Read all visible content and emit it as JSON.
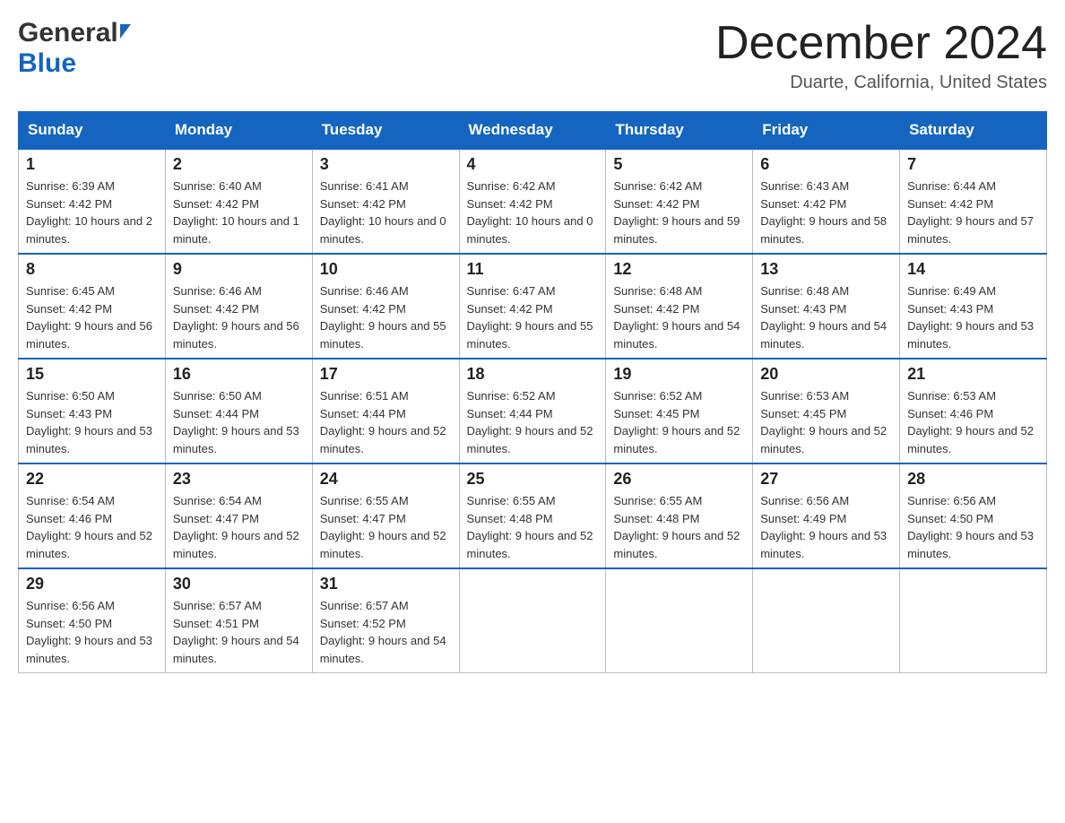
{
  "header": {
    "logo_general": "General",
    "logo_blue": "Blue",
    "month_title": "December 2024",
    "location": "Duarte, California, United States"
  },
  "weekdays": [
    "Sunday",
    "Monday",
    "Tuesday",
    "Wednesday",
    "Thursday",
    "Friday",
    "Saturday"
  ],
  "weeks": [
    [
      {
        "day": "1",
        "sunrise": "Sunrise: 6:39 AM",
        "sunset": "Sunset: 4:42 PM",
        "daylight": "Daylight: 10 hours and 2 minutes."
      },
      {
        "day": "2",
        "sunrise": "Sunrise: 6:40 AM",
        "sunset": "Sunset: 4:42 PM",
        "daylight": "Daylight: 10 hours and 1 minute."
      },
      {
        "day": "3",
        "sunrise": "Sunrise: 6:41 AM",
        "sunset": "Sunset: 4:42 PM",
        "daylight": "Daylight: 10 hours and 0 minutes."
      },
      {
        "day": "4",
        "sunrise": "Sunrise: 6:42 AM",
        "sunset": "Sunset: 4:42 PM",
        "daylight": "Daylight: 10 hours and 0 minutes."
      },
      {
        "day": "5",
        "sunrise": "Sunrise: 6:42 AM",
        "sunset": "Sunset: 4:42 PM",
        "daylight": "Daylight: 9 hours and 59 minutes."
      },
      {
        "day": "6",
        "sunrise": "Sunrise: 6:43 AM",
        "sunset": "Sunset: 4:42 PM",
        "daylight": "Daylight: 9 hours and 58 minutes."
      },
      {
        "day": "7",
        "sunrise": "Sunrise: 6:44 AM",
        "sunset": "Sunset: 4:42 PM",
        "daylight": "Daylight: 9 hours and 57 minutes."
      }
    ],
    [
      {
        "day": "8",
        "sunrise": "Sunrise: 6:45 AM",
        "sunset": "Sunset: 4:42 PM",
        "daylight": "Daylight: 9 hours and 56 minutes."
      },
      {
        "day": "9",
        "sunrise": "Sunrise: 6:46 AM",
        "sunset": "Sunset: 4:42 PM",
        "daylight": "Daylight: 9 hours and 56 minutes."
      },
      {
        "day": "10",
        "sunrise": "Sunrise: 6:46 AM",
        "sunset": "Sunset: 4:42 PM",
        "daylight": "Daylight: 9 hours and 55 minutes."
      },
      {
        "day": "11",
        "sunrise": "Sunrise: 6:47 AM",
        "sunset": "Sunset: 4:42 PM",
        "daylight": "Daylight: 9 hours and 55 minutes."
      },
      {
        "day": "12",
        "sunrise": "Sunrise: 6:48 AM",
        "sunset": "Sunset: 4:42 PM",
        "daylight": "Daylight: 9 hours and 54 minutes."
      },
      {
        "day": "13",
        "sunrise": "Sunrise: 6:48 AM",
        "sunset": "Sunset: 4:43 PM",
        "daylight": "Daylight: 9 hours and 54 minutes."
      },
      {
        "day": "14",
        "sunrise": "Sunrise: 6:49 AM",
        "sunset": "Sunset: 4:43 PM",
        "daylight": "Daylight: 9 hours and 53 minutes."
      }
    ],
    [
      {
        "day": "15",
        "sunrise": "Sunrise: 6:50 AM",
        "sunset": "Sunset: 4:43 PM",
        "daylight": "Daylight: 9 hours and 53 minutes."
      },
      {
        "day": "16",
        "sunrise": "Sunrise: 6:50 AM",
        "sunset": "Sunset: 4:44 PM",
        "daylight": "Daylight: 9 hours and 53 minutes."
      },
      {
        "day": "17",
        "sunrise": "Sunrise: 6:51 AM",
        "sunset": "Sunset: 4:44 PM",
        "daylight": "Daylight: 9 hours and 52 minutes."
      },
      {
        "day": "18",
        "sunrise": "Sunrise: 6:52 AM",
        "sunset": "Sunset: 4:44 PM",
        "daylight": "Daylight: 9 hours and 52 minutes."
      },
      {
        "day": "19",
        "sunrise": "Sunrise: 6:52 AM",
        "sunset": "Sunset: 4:45 PM",
        "daylight": "Daylight: 9 hours and 52 minutes."
      },
      {
        "day": "20",
        "sunrise": "Sunrise: 6:53 AM",
        "sunset": "Sunset: 4:45 PM",
        "daylight": "Daylight: 9 hours and 52 minutes."
      },
      {
        "day": "21",
        "sunrise": "Sunrise: 6:53 AM",
        "sunset": "Sunset: 4:46 PM",
        "daylight": "Daylight: 9 hours and 52 minutes."
      }
    ],
    [
      {
        "day": "22",
        "sunrise": "Sunrise: 6:54 AM",
        "sunset": "Sunset: 4:46 PM",
        "daylight": "Daylight: 9 hours and 52 minutes."
      },
      {
        "day": "23",
        "sunrise": "Sunrise: 6:54 AM",
        "sunset": "Sunset: 4:47 PM",
        "daylight": "Daylight: 9 hours and 52 minutes."
      },
      {
        "day": "24",
        "sunrise": "Sunrise: 6:55 AM",
        "sunset": "Sunset: 4:47 PM",
        "daylight": "Daylight: 9 hours and 52 minutes."
      },
      {
        "day": "25",
        "sunrise": "Sunrise: 6:55 AM",
        "sunset": "Sunset: 4:48 PM",
        "daylight": "Daylight: 9 hours and 52 minutes."
      },
      {
        "day": "26",
        "sunrise": "Sunrise: 6:55 AM",
        "sunset": "Sunset: 4:48 PM",
        "daylight": "Daylight: 9 hours and 52 minutes."
      },
      {
        "day": "27",
        "sunrise": "Sunrise: 6:56 AM",
        "sunset": "Sunset: 4:49 PM",
        "daylight": "Daylight: 9 hours and 53 minutes."
      },
      {
        "day": "28",
        "sunrise": "Sunrise: 6:56 AM",
        "sunset": "Sunset: 4:50 PM",
        "daylight": "Daylight: 9 hours and 53 minutes."
      }
    ],
    [
      {
        "day": "29",
        "sunrise": "Sunrise: 6:56 AM",
        "sunset": "Sunset: 4:50 PM",
        "daylight": "Daylight: 9 hours and 53 minutes."
      },
      {
        "day": "30",
        "sunrise": "Sunrise: 6:57 AM",
        "sunset": "Sunset: 4:51 PM",
        "daylight": "Daylight: 9 hours and 54 minutes."
      },
      {
        "day": "31",
        "sunrise": "Sunrise: 6:57 AM",
        "sunset": "Sunset: 4:52 PM",
        "daylight": "Daylight: 9 hours and 54 minutes."
      },
      null,
      null,
      null,
      null
    ]
  ]
}
